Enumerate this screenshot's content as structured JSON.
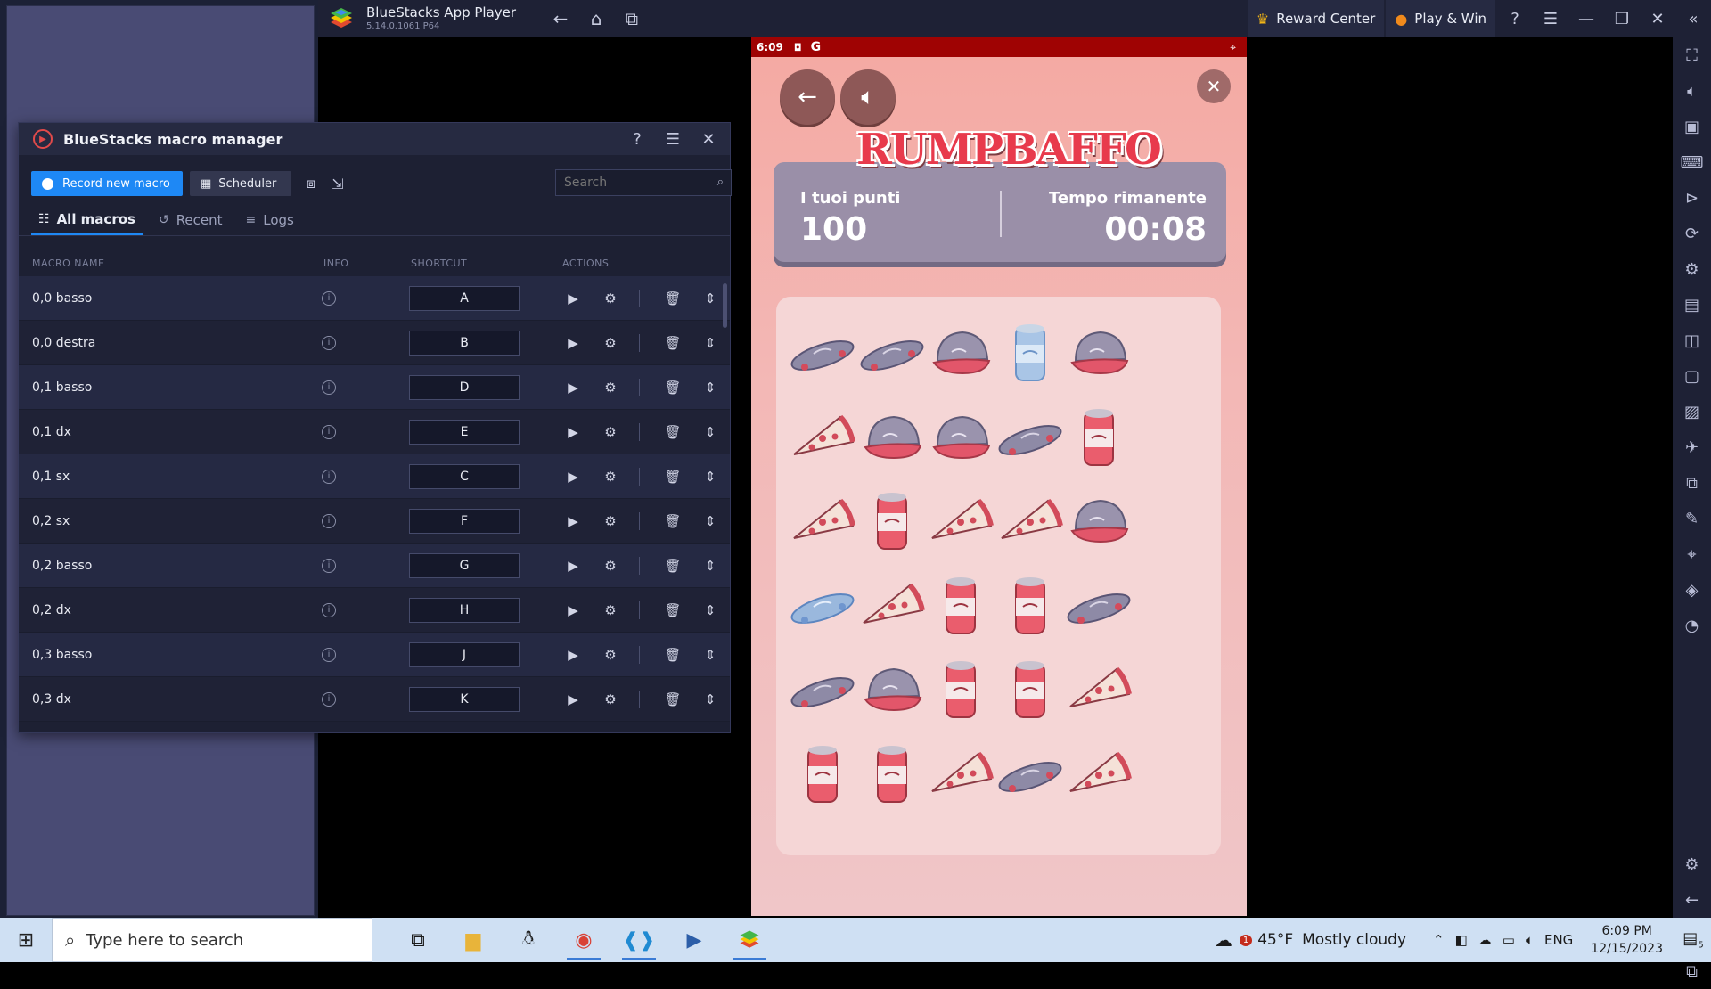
{
  "window": {
    "app_title": "BlueStacks App Player",
    "app_version": "5.14.0.1061  P64",
    "reward_center": "Reward Center",
    "play_and_win": "Play & Win"
  },
  "phone": {
    "status_time": "6:09",
    "game_title": "RUMPBAFFO",
    "score_label": "I tuoi punti",
    "score_value": "100",
    "time_label": "Tempo rimanente",
    "time_value": "00:08",
    "board_rows": [
      [
        "skateboard",
        "skateboard",
        "cap",
        "can-selected",
        "cap"
      ],
      [
        "pizza",
        "cap",
        "cap",
        "skateboard",
        "can"
      ],
      [
        "pizza",
        "can",
        "pizza",
        "pizza",
        "cap"
      ],
      [
        "skateboard-selected",
        "pizza",
        "can",
        "can",
        "skateboard"
      ],
      [
        "skateboard",
        "cap",
        "can",
        "can",
        "pizza"
      ],
      [
        "can",
        "can",
        "pizza",
        "skateboard",
        "pizza"
      ]
    ]
  },
  "macro_manager": {
    "title": "BlueStacks macro manager",
    "record_button": "Record new macro",
    "scheduler_button": "Scheduler",
    "search_placeholder": "Search",
    "tabs": [
      "All macros",
      "Recent",
      "Logs"
    ],
    "columns": [
      "MACRO NAME",
      "INFO",
      "SHORTCUT",
      "ACTIONS"
    ],
    "macros": [
      {
        "name": "0,0 basso",
        "shortcut": "A"
      },
      {
        "name": "0,0 destra",
        "shortcut": "B"
      },
      {
        "name": "0,1 basso",
        "shortcut": "D"
      },
      {
        "name": "0,1 dx",
        "shortcut": "E"
      },
      {
        "name": "0,1 sx",
        "shortcut": "C"
      },
      {
        "name": "0,2  sx",
        "shortcut": "F"
      },
      {
        "name": "0,2 basso",
        "shortcut": "G"
      },
      {
        "name": "0,2 dx",
        "shortcut": "H"
      },
      {
        "name": "0,3 basso",
        "shortcut": "J"
      },
      {
        "name": "0,3 dx",
        "shortcut": "K"
      }
    ]
  },
  "taskbar": {
    "search_placeholder": "Type here to search",
    "weather_temp": "45°F",
    "weather_text": "Mostly cloudy",
    "weather_badge": "1",
    "language": "ENG",
    "time": "6:09 PM",
    "date": "12/15/2023",
    "notification_count": "5"
  }
}
